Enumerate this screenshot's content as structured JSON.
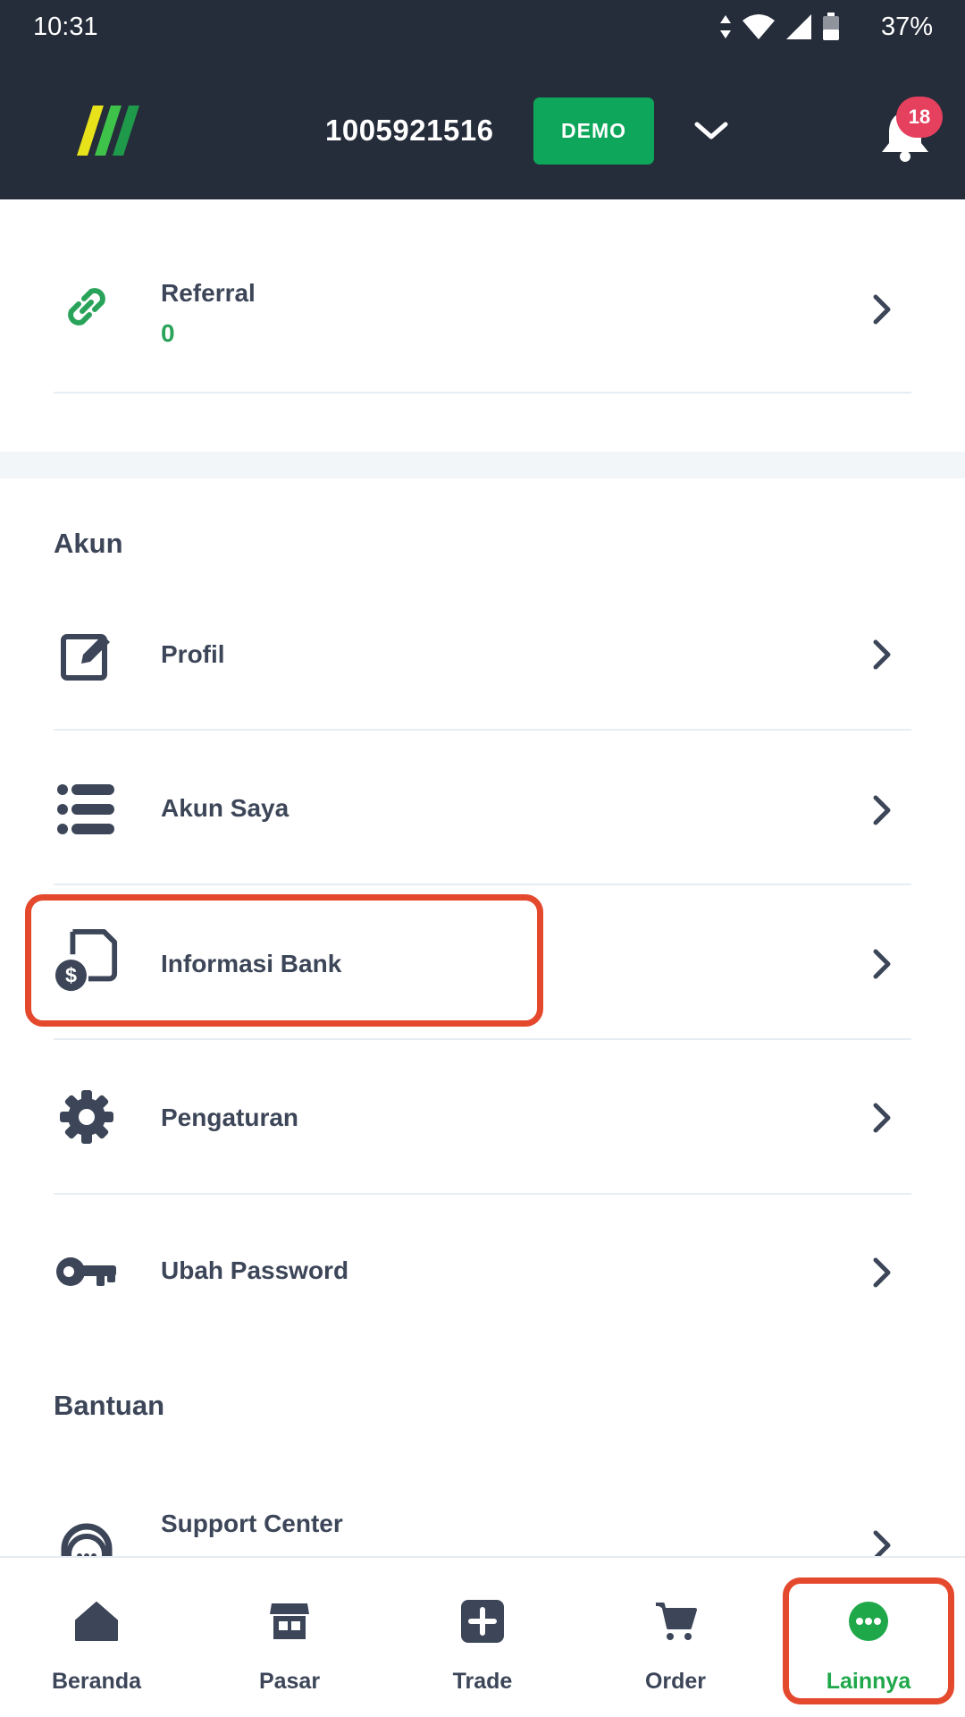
{
  "status_bar": {
    "time": "10:31",
    "battery": "37%"
  },
  "header": {
    "account_number": "1005921516",
    "mode_badge": "DEMO",
    "notification_count": "18"
  },
  "referral": {
    "label": "Referral",
    "value": "0"
  },
  "sections": {
    "akun": {
      "title": "Akun",
      "items": [
        {
          "label": "Profil",
          "icon": "edit-icon"
        },
        {
          "label": "Akun Saya",
          "icon": "list-icon"
        },
        {
          "label": "Informasi Bank",
          "icon": "bank-document-icon"
        },
        {
          "label": "Pengaturan",
          "icon": "gear-icon"
        },
        {
          "label": "Ubah Password",
          "icon": "key-icon"
        }
      ]
    },
    "bantuan": {
      "title": "Bantuan",
      "items": [
        {
          "label": "Support Center",
          "icon": "headset-icon"
        }
      ]
    }
  },
  "bottom_nav": [
    {
      "label": "Beranda",
      "icon": "home-icon"
    },
    {
      "label": "Pasar",
      "icon": "store-icon"
    },
    {
      "label": "Trade",
      "icon": "plus-square-icon"
    },
    {
      "label": "Order",
      "icon": "cart-icon"
    },
    {
      "label": "Lainnya",
      "icon": "more-icon",
      "active": true
    }
  ],
  "colors": {
    "header_bg": "#252c3a",
    "accent_green": "#0ea65a",
    "badge_red": "#e5405e",
    "highlight": "#e4492e",
    "text": "#3c4658"
  }
}
